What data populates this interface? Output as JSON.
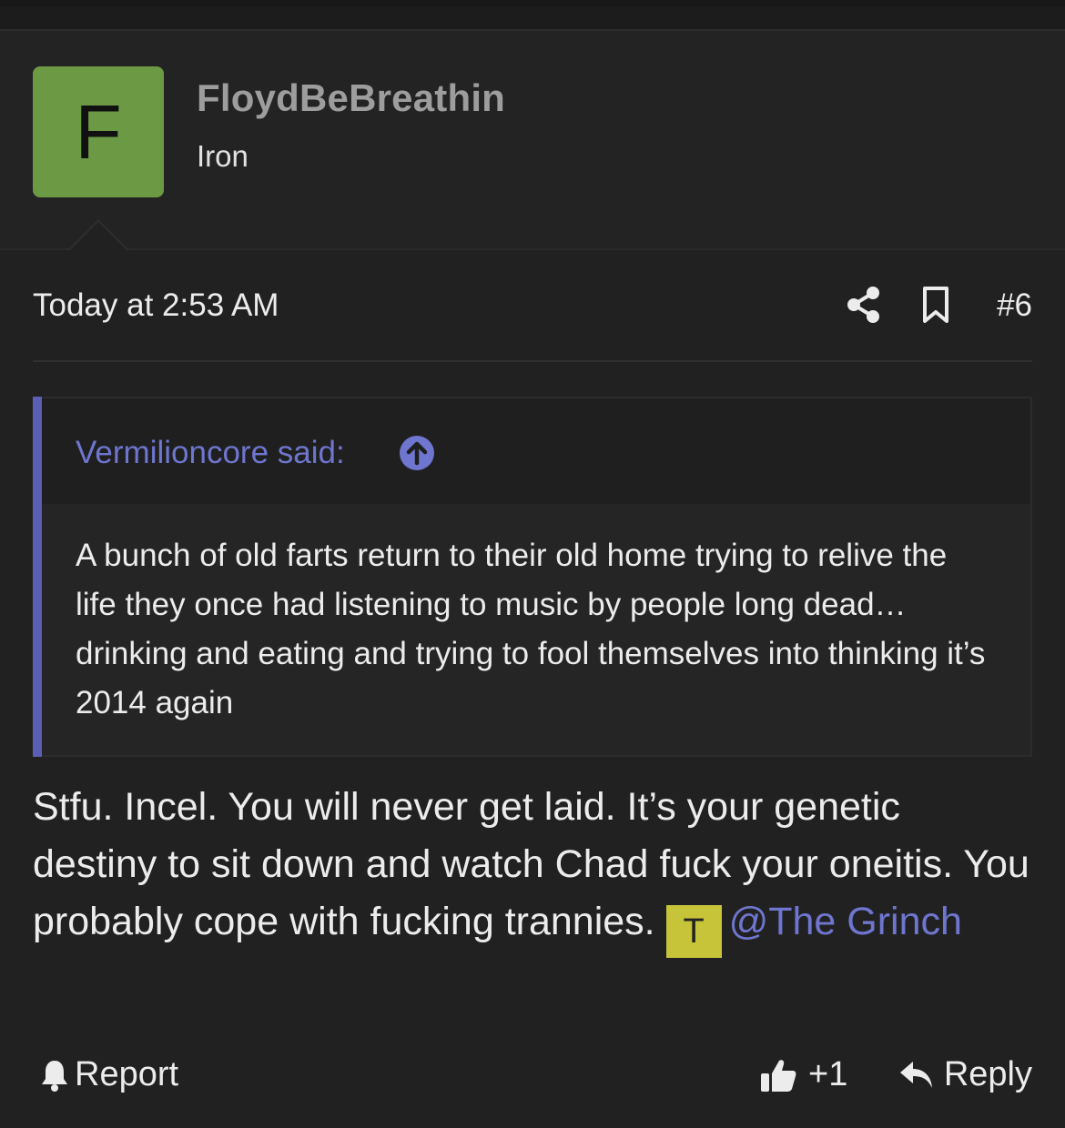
{
  "user": {
    "avatar_letter": "F",
    "avatar_color": "#6c9a44",
    "name": "FloydBeBreathin",
    "rank": "Iron"
  },
  "post": {
    "timestamp": "Today at 2:53 AM",
    "number": "#6",
    "share_icon": "share-icon",
    "bookmark_icon": "bookmark-icon"
  },
  "quote": {
    "author_label": "Vermilioncore said:",
    "jump_icon": "arrow-up-circle-icon",
    "text": "A bunch of old farts return to their old home trying to relive the life they once had listening to music by people long dead…drinking and eating and trying to fool themselves into thinking it’s 2014 again",
    "accent_color": "#5a5fb3"
  },
  "message": {
    "text": "Stfu. Incel. You will never get laid. It’s your genetic destiny to sit down and watch Chad fuck your oneitis. You probably cope with fucking trannies. ",
    "mention_avatar_letter": "T",
    "mention_avatar_color": "#c7c43a",
    "mention": "@The Grinch"
  },
  "actions": {
    "report_label": "Report",
    "like_count": "+1",
    "reply_label": "Reply"
  }
}
